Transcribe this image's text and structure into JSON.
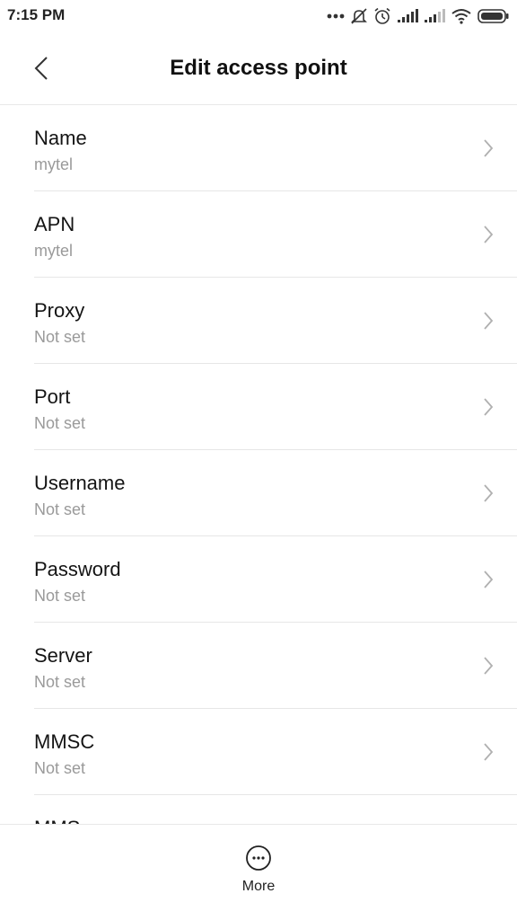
{
  "status_bar": {
    "time": "7:15 PM",
    "icons": [
      "more-dots-icon",
      "mute-icon",
      "alarm-icon",
      "signal-icon",
      "signal-icon-2",
      "wifi-icon",
      "battery-icon"
    ]
  },
  "header": {
    "title": "Edit access point",
    "back_icon": "back-chevron-icon"
  },
  "settings": [
    {
      "label": "Name",
      "value": "mytel"
    },
    {
      "label": "APN",
      "value": "mytel"
    },
    {
      "label": "Proxy",
      "value": "Not set"
    },
    {
      "label": "Port",
      "value": "Not set"
    },
    {
      "label": "Username",
      "value": "Not set"
    },
    {
      "label": "Password",
      "value": "Not set"
    },
    {
      "label": "Server",
      "value": "Not set"
    },
    {
      "label": "MMSC",
      "value": "Not set"
    },
    {
      "label": "MMS",
      "value": ""
    }
  ],
  "bottom_bar": {
    "more_label": "More",
    "more_icon": "more-circle-icon"
  },
  "colors": {
    "background": "#ffffff",
    "primary_text": "#141414",
    "secondary_text": "#9a9a9a",
    "divider": "#e6e6e6",
    "chevron": "#b0b0b0"
  }
}
